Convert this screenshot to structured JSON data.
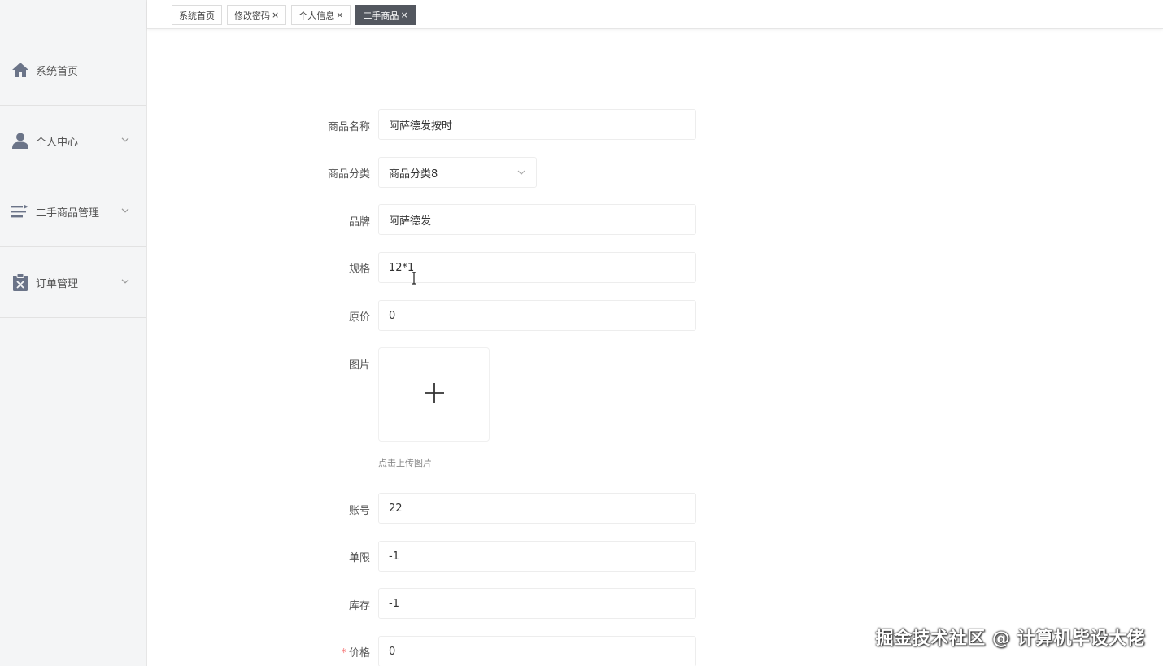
{
  "sidebar": {
    "items": [
      {
        "label": "系统首页",
        "icon": "home-icon",
        "has_arrow": false
      },
      {
        "label": "个人中心",
        "icon": "user-icon",
        "has_arrow": true
      },
      {
        "label": "二手商品管理",
        "icon": "list-icon",
        "has_arrow": true
      },
      {
        "label": "订单管理",
        "icon": "clipboard-x-icon",
        "has_arrow": true
      }
    ]
  },
  "tabs": [
    {
      "label": "系统首页",
      "closable": false,
      "active": false
    },
    {
      "label": "修改密码",
      "closable": true,
      "active": false
    },
    {
      "label": "个人信息",
      "closable": true,
      "active": false
    },
    {
      "label": "二手商品",
      "closable": true,
      "active": true
    }
  ],
  "tab_close_glyph": "×",
  "form": {
    "name": {
      "label": "商品名称",
      "value": "阿萨德发按时"
    },
    "category": {
      "label": "商品分类",
      "value": "商品分类8"
    },
    "brand": {
      "label": "品牌",
      "value": "阿萨德发"
    },
    "spec": {
      "label": "规格",
      "value": "12*1"
    },
    "original_price": {
      "label": "原价",
      "value": "0"
    },
    "image": {
      "label": "图片",
      "hint": "点击上传图片"
    },
    "account": {
      "label": "账号",
      "value": "22"
    },
    "limit": {
      "label": "单限",
      "value": "-1"
    },
    "stock": {
      "label": "库存",
      "value": "-1"
    },
    "price": {
      "label": "价格",
      "value": "0",
      "required_mark": "*"
    }
  },
  "watermark": "掘金技术社区 @ 计算机毕设大佬",
  "colors": {
    "sidebar_bg": "#f4f5f6",
    "icon": "#6b7488",
    "active_tab_bg": "#53575f",
    "required": "#f56c6c"
  }
}
